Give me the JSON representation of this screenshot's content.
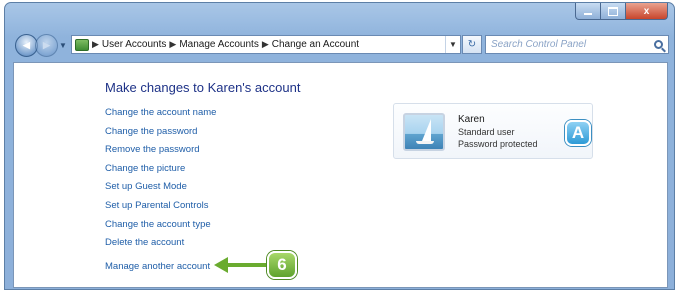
{
  "window": {
    "caption_close": "x"
  },
  "navbar": {
    "back_glyph": "◀",
    "forward_glyph": "▶",
    "breadcrumbs": [
      "User Accounts",
      "Manage Accounts",
      "Change an Account"
    ],
    "separator": "▶",
    "search_placeholder": "Search Control Panel"
  },
  "page": {
    "title": "Make changes to Karen's account",
    "tasks": [
      "Change the account name",
      "Change the password",
      "Remove the password",
      "Change the picture",
      "Set up Guest Mode",
      "Set up Parental Controls",
      "Change the account type",
      "Delete the account"
    ],
    "manage_link": "Manage another account"
  },
  "account": {
    "name": "Karen",
    "type": "Standard user",
    "password_status": "Password protected"
  },
  "callouts": {
    "a_label": "A",
    "step_label": "6",
    "step_color": "#6aab2f",
    "a_color": "#2d9ad6"
  },
  "icons": [
    "back-icon",
    "forward-icon",
    "control-panel-icon",
    "refresh-icon",
    "search-icon",
    "user-picture-icon"
  ]
}
